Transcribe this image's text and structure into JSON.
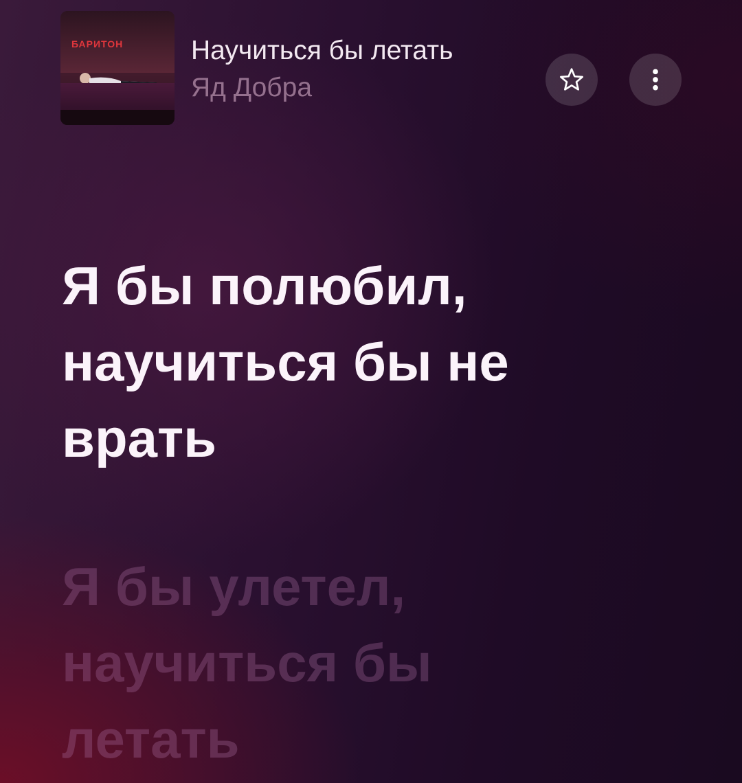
{
  "now_playing": {
    "cover_text": "БАРИТОН",
    "title": "Научиться бы летать",
    "artist": "Яд Добра",
    "favorite_icon": "star-icon",
    "more_icon": "more-vertical-icon"
  },
  "lyrics": {
    "current": [
      "Я бы полюбил,",
      "научиться бы не",
      "врать"
    ],
    "next": [
      "Я бы улетел,",
      "научиться бы",
      "летать"
    ]
  },
  "colors": {
    "text_primary": "#fbf3fa",
    "text_muted": "#aa6ea0"
  }
}
